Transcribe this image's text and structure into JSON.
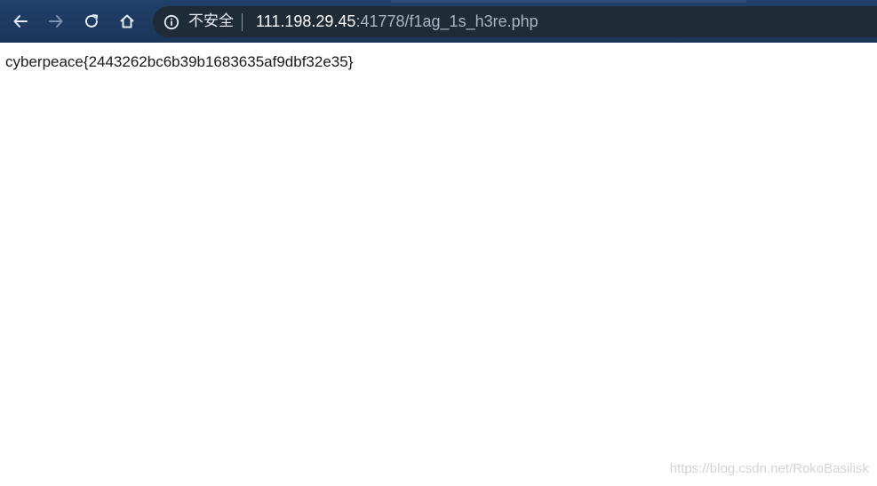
{
  "browser": {
    "security_label": "不安全",
    "url_host": "111.198.29.45",
    "url_rest": ":41778/f1ag_1s_h3re.php"
  },
  "page": {
    "text": "cyberpeace{2443262bc6b39b1683635af9dbf32e35}"
  },
  "watermark": "https://blog.csdn.net/RokoBasilisk",
  "icons": {
    "back": "back-arrow-icon",
    "forward": "forward-arrow-icon",
    "reload": "reload-icon",
    "home": "home-icon",
    "info": "info-icon"
  }
}
